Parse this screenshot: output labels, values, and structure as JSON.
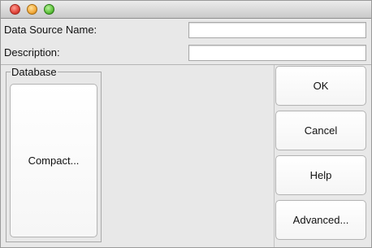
{
  "window": {
    "controls": [
      "close",
      "minimize",
      "zoom"
    ]
  },
  "form": {
    "data_source_name_label": "Data Source Name:",
    "data_source_name_value": "",
    "description_label": "Description:",
    "description_value": ""
  },
  "database_group": {
    "legend": "Database",
    "compact_label": "Compact..."
  },
  "buttons": {
    "ok": "OK",
    "cancel": "Cancel",
    "help": "Help",
    "advanced": "Advanced..."
  },
  "colors": {
    "window_bg": "#e8e8e8",
    "close": "#e0443a",
    "minimize": "#f2a93a",
    "zoom": "#5fc23c"
  }
}
